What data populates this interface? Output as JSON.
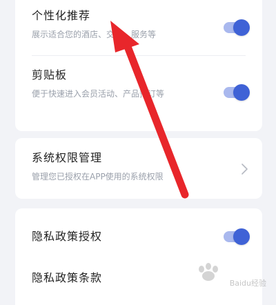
{
  "settings_group_1": {
    "items": [
      {
        "title": "个性化推荐",
        "description": "展示适合您的酒店、交通、服务等",
        "toggle_on": true
      },
      {
        "title": "剪贴板",
        "description": "便于快速进入会员活动、产品预订等",
        "toggle_on": true
      }
    ]
  },
  "settings_group_2": {
    "items": [
      {
        "title": "系统权限管理",
        "description": "管理您已授权在APP使用的系统权限"
      }
    ]
  },
  "settings_group_3": {
    "items": [
      {
        "title": "隐私政策授权",
        "toggle_on": true
      },
      {
        "title": "隐私政策条款"
      }
    ]
  },
  "annotation": {
    "arrow_color": "#e8262b"
  },
  "watermark": {
    "text": "Baidu经验",
    "url": "jingyan.baidu.com"
  },
  "colors": {
    "background": "#f2f3f7",
    "toggle_track": "#a9b8ee",
    "toggle_knob": "#3f62d6",
    "title_text": "#222222",
    "desc_text": "#9aa0ab"
  }
}
